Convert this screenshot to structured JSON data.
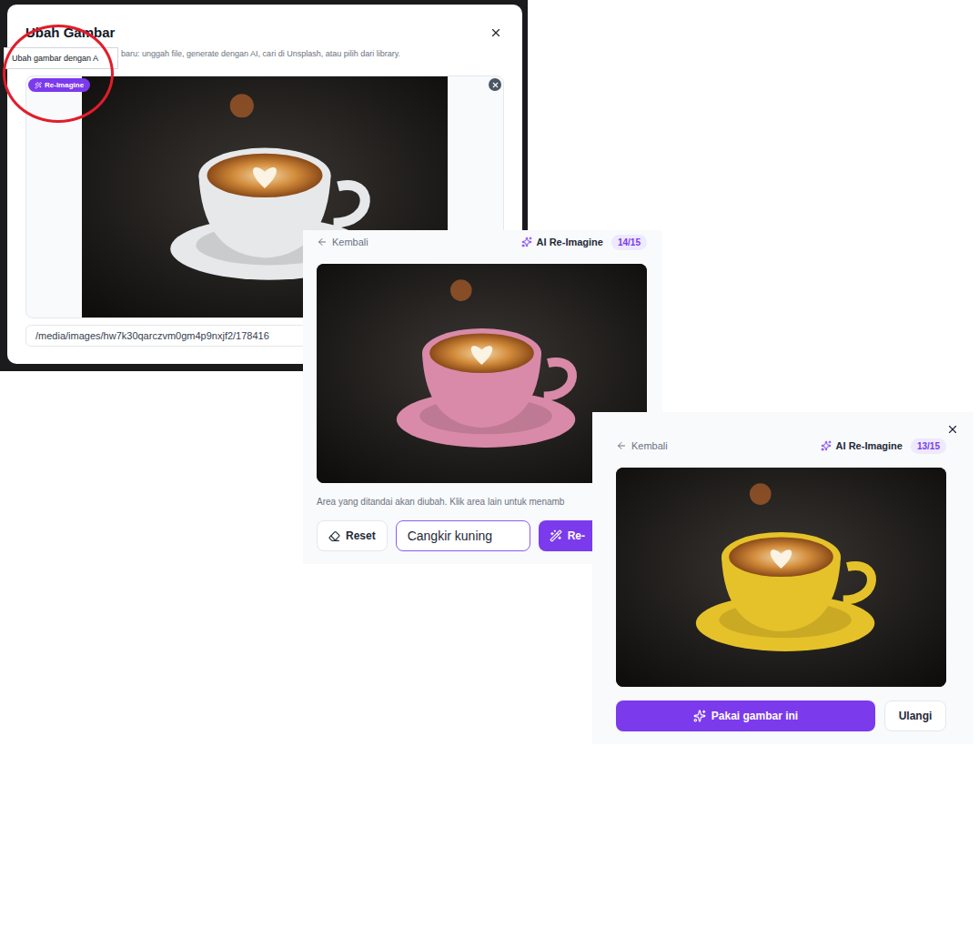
{
  "editor_dialog": {
    "title": "Ubah Gambar",
    "subtitle": "baru: unggah file, generate dengan AI, cari di Unsplash, atau pilih dari library.",
    "tooltip": "Ubah gambar dengan A",
    "badge": "Re-Imagine",
    "url": "/media/images/hw7k30qarczvm0gm4p9nxjf2/178416"
  },
  "mask_panel": {
    "back": "Kembali",
    "title": "AI Re-Imagine",
    "quota": "14/15",
    "hint": "Area yang ditandai akan diubah. Klik area lain untuk menamb",
    "reset": "Reset",
    "prompt": "Cangkir kuning",
    "submit": "Re-"
  },
  "result_panel": {
    "back": "Kembali",
    "title": "AI Re-Imagine",
    "quota": "13/15",
    "use": "Pakai gambar ini",
    "retry": "Ulangi"
  }
}
